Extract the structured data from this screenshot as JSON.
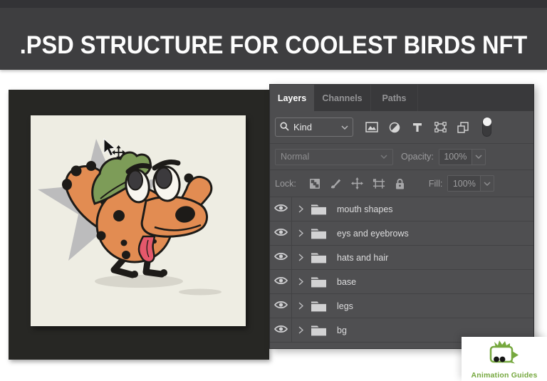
{
  "header": {
    "title": ".PSD STRUCTURE FOR COOLEST BIRDS NFT"
  },
  "panel": {
    "tabs": [
      {
        "label": "Layers",
        "active": true
      },
      {
        "label": "Channels",
        "active": false
      },
      {
        "label": "Paths",
        "active": false
      }
    ],
    "filter_row": {
      "kind_label": "Kind",
      "icons": [
        "search-icon",
        "pixel-layer-filter-icon",
        "adjustment-layer-filter-icon",
        "type-layer-filter-icon",
        "shape-layer-filter-icon",
        "smart-object-filter-icon",
        "filter-toggle"
      ]
    },
    "blend_row": {
      "mode": "Normal",
      "opacity_label": "Opacity:",
      "opacity_value": "100%"
    },
    "lock_row": {
      "lock_label": "Lock:",
      "icons": [
        "lock-transparency-icon",
        "lock-pixels-icon",
        "lock-position-icon",
        "lock-artboard-icon",
        "lock-all-icon"
      ],
      "fill_label": "Fill:",
      "fill_value": "100%"
    },
    "layers": [
      {
        "name": "mouth shapes"
      },
      {
        "name": "eys and eyebrows"
      },
      {
        "name": "hats and hair"
      },
      {
        "name": "base"
      },
      {
        "name": "legs"
      },
      {
        "name": "bg"
      }
    ]
  },
  "logo": {
    "text": "Animation Guides"
  },
  "colors": {
    "header_bg": "#3e3e40",
    "panel_bg": "#4d4d4f",
    "tab_strip_bg": "#39393b",
    "row_separator": "#424244",
    "canvas_frame": "#272724",
    "canvas_bg": "#eeede3",
    "character_orange": "#e28c52",
    "hat_green": "#7d9c58",
    "tongue_pink": "#e5586b",
    "star_gray": "#bcbcbd",
    "outline_black": "#1d1b18",
    "logo_green": "#76a83f"
  }
}
